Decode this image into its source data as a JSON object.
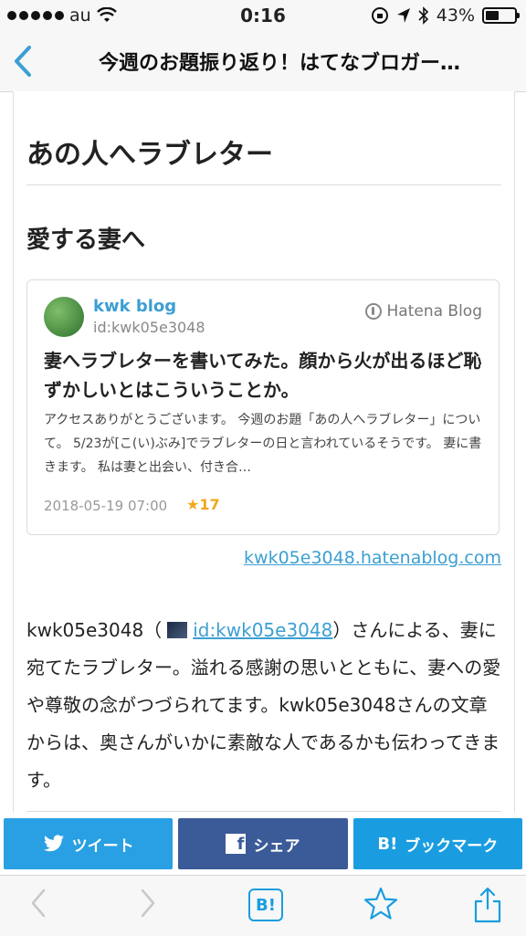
{
  "status_bar": {
    "carrier": "au",
    "time": "0:16",
    "battery": "43%"
  },
  "nav": {
    "title": "今週のお題振り返り！はてなブロガー…"
  },
  "article": {
    "heading": "あの人へラブレター",
    "subheading": "愛する妻へ",
    "card": {
      "blog_name": "kwk blog",
      "blog_id": "id:kwk05e3048",
      "service": "Hatena Blog",
      "title": "妻へラブレターを書いてみた。顔から火が出るほど恥ずかしいとはこういうことか。",
      "excerpt": "アクセスありがとうございます。 今週のお題「あの人へラブレター」について。 5/23が[こ(い)ぶみ]でラブレターの日と言われているそうです。 妻に書きます。 私は妻と出会い、付き合…",
      "date": "2018-05-19 07:00",
      "stars": "★17"
    },
    "source_link": "kwk05e3048.hatenablog.com",
    "body": {
      "prefix": "kwk05e3048（",
      "user_link": "id:kwk05e3048",
      "suffix": "）さんによる、妻に宛てたラブレター。溢れる感謝の思いとともに、妻への愛や尊敬の念がつづられてます。kwk05e3048さんの文章からは、奥さんがいかに素敵な人であるかも伝わってきます。"
    }
  },
  "share": {
    "tweet": "ツイート",
    "facebook": "シェア",
    "bookmark": "ブックマーク"
  },
  "toolbar": {
    "hatena": "B!"
  },
  "colors": {
    "accent": "#3c9fd2",
    "twitter": "#29a0e3",
    "facebook": "#3b5a98",
    "hatena": "#1a9de0",
    "star": "#f0a81e"
  }
}
